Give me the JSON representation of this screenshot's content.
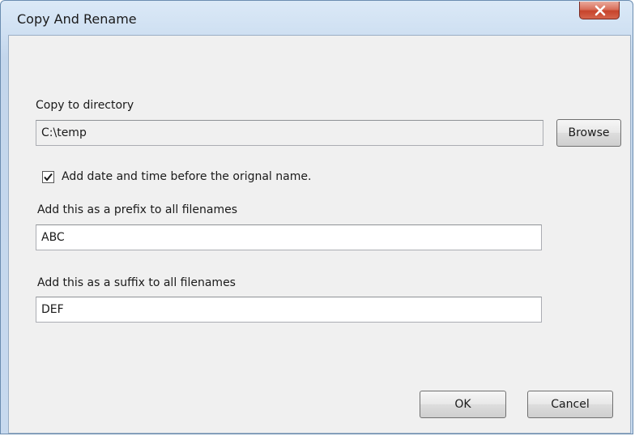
{
  "window": {
    "title": "Copy And Rename"
  },
  "directory": {
    "label": "Copy to directory",
    "value": "C:\\temp",
    "browse_label": "Browse"
  },
  "date_time_option": {
    "label": "Add date and time before the orignal name.",
    "checked": true
  },
  "prefix": {
    "label": "Add this as a prefix to all filenames",
    "value": "ABC"
  },
  "suffix": {
    "label": "Add this as a suffix to all filenames",
    "value": "DEF"
  },
  "buttons": {
    "ok_label": "OK",
    "cancel_label": "Cancel"
  },
  "icons": {
    "close": "close-icon",
    "check": "checkmark-icon"
  },
  "colors": {
    "close_button": "#c7442c",
    "frame": "#c3d6ec",
    "client_background": "#f0f0f0"
  }
}
